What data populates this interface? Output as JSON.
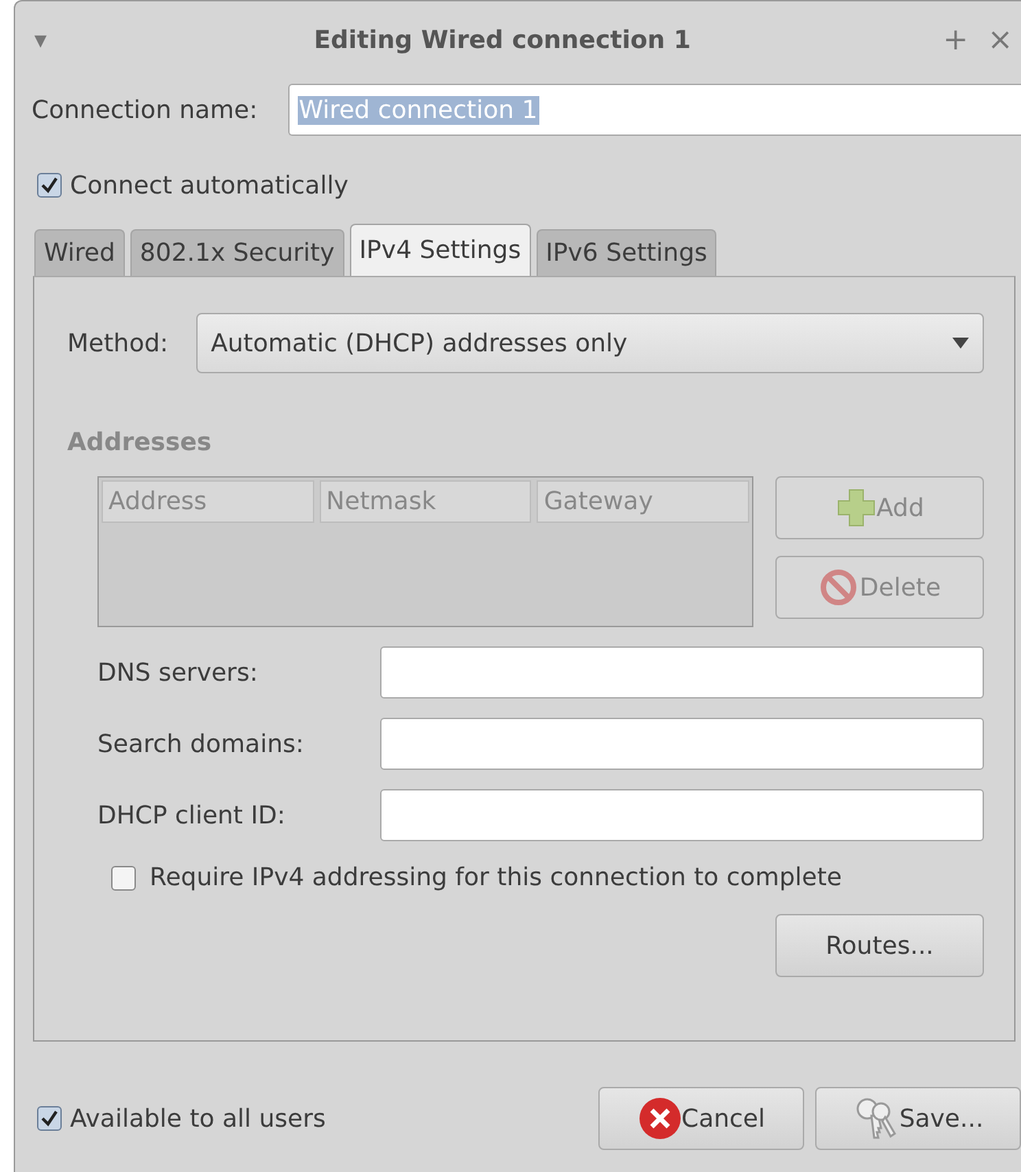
{
  "window": {
    "title": "Editing Wired connection 1",
    "menu_glyph": "▾",
    "controls": [
      "+",
      "×"
    ]
  },
  "connection_name": {
    "label": "Connection name:",
    "value": "Wired connection 1",
    "selected_text": true
  },
  "connect_automatically": {
    "label": "Connect automatically",
    "checked": true
  },
  "tabs": [
    {
      "label": "Wired",
      "selected": false
    },
    {
      "label": "802.1x Security",
      "selected": false
    },
    {
      "label": "IPv4 Settings",
      "selected": true
    },
    {
      "label": "IPv6 Settings",
      "selected": false
    }
  ],
  "method": {
    "label": "Method:",
    "value": "Automatic (DHCP) addresses only"
  },
  "addresses": {
    "title": "Addresses",
    "disabled": true,
    "columns": [
      "Address",
      "Netmask",
      "Gateway"
    ],
    "buttons": [
      {
        "label": "Add",
        "kind": "add",
        "disabled": true
      },
      {
        "label": "Delete",
        "kind": "delete",
        "disabled": true
      }
    ]
  },
  "fields": [
    {
      "label": "DNS servers:"
    },
    {
      "label": "Search domains:"
    },
    {
      "label": "DHCP client ID:"
    }
  ],
  "require_ipv4": {
    "label": "Require IPv4 addressing for this connection to complete",
    "checked": false
  },
  "routes_button": "Routes...",
  "available_to_all_users": {
    "label": "Available to all users",
    "checked": true
  },
  "buttons": [
    {
      "label": "Cancel",
      "kind": "cancel"
    },
    {
      "label": "Save...",
      "kind": "save"
    }
  ]
}
